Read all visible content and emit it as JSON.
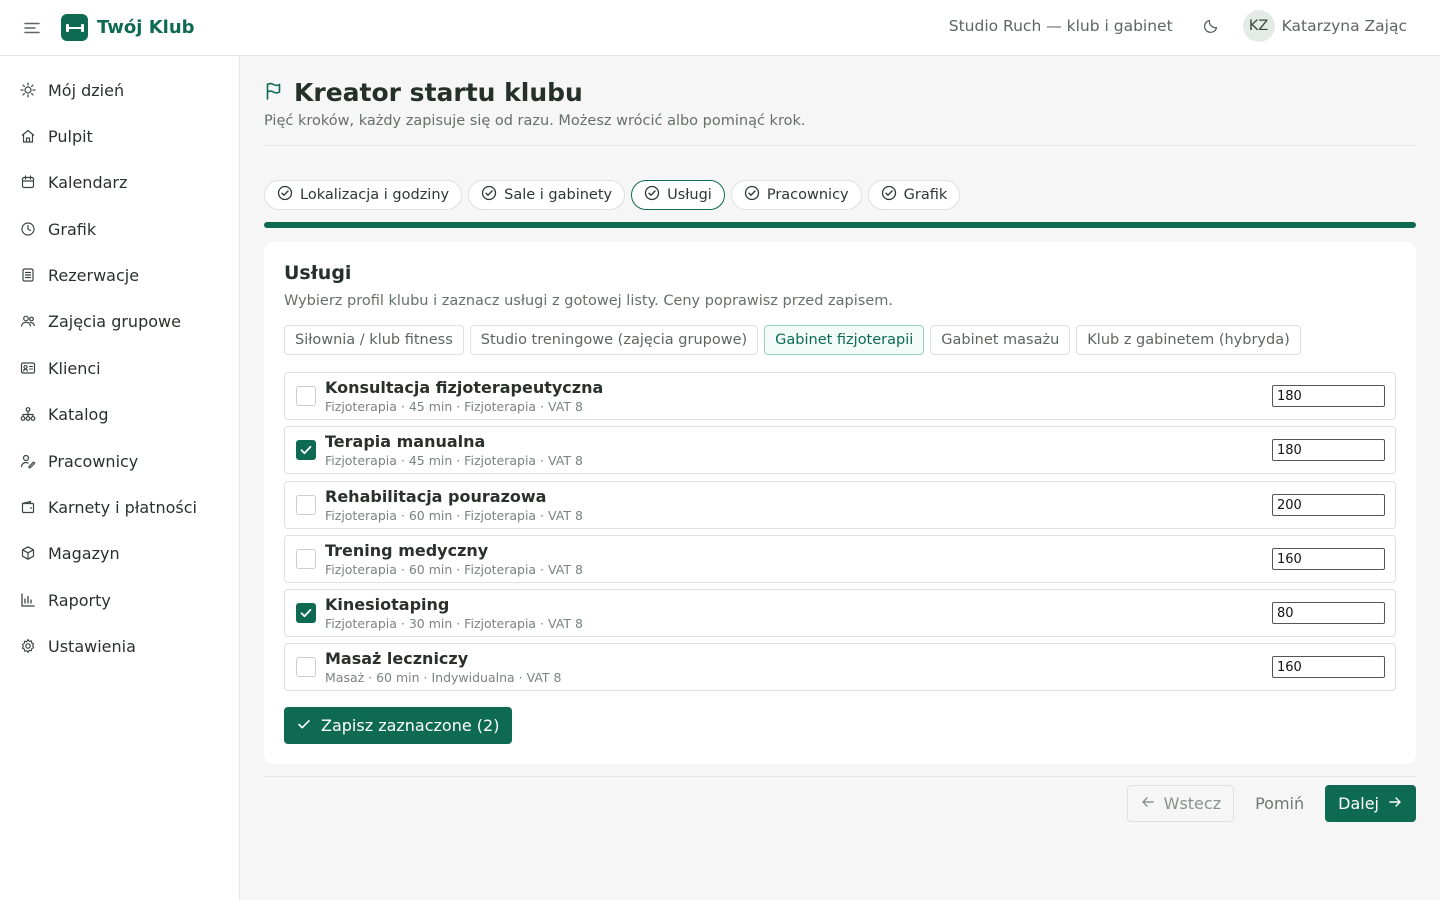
{
  "topbar": {
    "menu_icon": "menu-icon",
    "app_name": "Twój Klub",
    "club_name": "Studio Ruch — klub i gabinet",
    "theme_icon": "moon-icon",
    "user_initials": "KZ",
    "user_name": "Katarzyna Zając"
  },
  "sidebar": {
    "items": [
      {
        "label": "Mój dzień",
        "icon": "sun-icon"
      },
      {
        "label": "Pulpit",
        "icon": "home-icon"
      },
      {
        "label": "Kalendarz",
        "icon": "calendar-icon"
      },
      {
        "label": "Grafik",
        "icon": "clock-icon"
      },
      {
        "label": "Rezerwacje",
        "icon": "list-icon"
      },
      {
        "label": "Zajęcia grupowe",
        "icon": "users-icon"
      },
      {
        "label": "Klienci",
        "icon": "id-card-icon"
      },
      {
        "label": "Katalog",
        "icon": "sitemap-icon"
      },
      {
        "label": "Pracownicy",
        "icon": "user-edit-icon"
      },
      {
        "label": "Karnety i płatności",
        "icon": "wallet-icon"
      },
      {
        "label": "Magazyn",
        "icon": "box-icon"
      },
      {
        "label": "Raporty",
        "icon": "bar-chart-icon"
      },
      {
        "label": "Ustawienia",
        "icon": "gear-icon"
      }
    ]
  },
  "page": {
    "title": "Kreator startu klubu",
    "title_icon": "flag-icon",
    "subtitle": "Pięć kroków, każdy zapisuje się od razu. Możesz wrócić albo pominąć krok."
  },
  "steps": [
    {
      "label": "Lokalizacja i godziny",
      "done": true,
      "active": false
    },
    {
      "label": "Sale i gabinety",
      "done": true,
      "active": false
    },
    {
      "label": "Usługi",
      "done": true,
      "active": true
    },
    {
      "label": "Pracownicy",
      "done": true,
      "active": false
    },
    {
      "label": "Grafik",
      "done": true,
      "active": false
    }
  ],
  "progress": 1.0,
  "services_card": {
    "title": "Usługi",
    "subtitle": "Wybierz profil klubu i zaznacz usługi z gotowej listy. Ceny poprawisz przed zapisem.",
    "profiles": [
      {
        "label": "Siłownia / klub fitness",
        "active": false
      },
      {
        "label": "Studio treningowe (zajęcia grupowe)",
        "active": false
      },
      {
        "label": "Gabinet fizjoterapii",
        "active": true
      },
      {
        "label": "Gabinet masażu",
        "active": false
      },
      {
        "label": "Klub z gabinetem (hybryda)",
        "active": false
      }
    ],
    "services": [
      {
        "name": "Konsultacja fizjoterapeutyczna",
        "meta": "Fizjoterapia · 45 min · Fizjoterapia · VAT 8",
        "price": "180",
        "checked": false
      },
      {
        "name": "Terapia manualna",
        "meta": "Fizjoterapia · 45 min · Fizjoterapia · VAT 8",
        "price": "180",
        "checked": true
      },
      {
        "name": "Rehabilitacja pourazowa",
        "meta": "Fizjoterapia · 60 min · Fizjoterapia · VAT 8",
        "price": "200",
        "checked": false
      },
      {
        "name": "Trening medyczny",
        "meta": "Fizjoterapia · 60 min · Fizjoterapia · VAT 8",
        "price": "160",
        "checked": false
      },
      {
        "name": "Kinesiotaping",
        "meta": "Fizjoterapia · 30 min · Fizjoterapia · VAT 8",
        "price": "80",
        "checked": true
      },
      {
        "name": "Masaż leczniczy",
        "meta": "Masaż · 60 min · Indywidualna · VAT 8",
        "price": "160",
        "checked": false
      }
    ],
    "save_label": "Zapisz zaznaczone (2)"
  },
  "footer": {
    "back_label": "Wstecz",
    "skip_label": "Pomiń",
    "next_label": "Dalej"
  },
  "colors": {
    "accent": "#0e6b52",
    "accent_light": "#f3fbf8",
    "border": "#dde1df",
    "text_muted": "#66706a"
  }
}
